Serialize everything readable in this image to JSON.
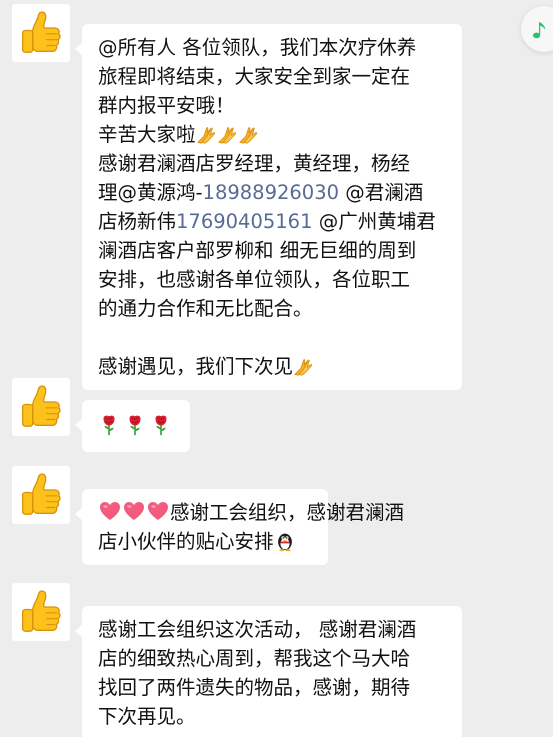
{
  "colors": {
    "background": "#ededed",
    "bubble": "#ffffff",
    "text": "#111111",
    "phone_link": "#576b95",
    "music_note": "#2bc26b"
  },
  "floating": {
    "icon": "music-note-icon"
  },
  "messages": [
    {
      "avatar": "thumbs-up-avatar",
      "lines": [
        "@所有人 各位领队，我们本次疗休养",
        "旅程即将结束，大家安全到家一定在",
        "群内报平安哦！",
        "辛苦大家啦",
        "感谢君澜酒店罗经理，黄经理，杨经",
        "理@黄源鸿-",
        "18988926030",
        " @君澜酒",
        "店杨新伟",
        "17690405161",
        " @广州黄埔君",
        "澜酒店客户部罗柳和 细无巨细的周到",
        "安排，也感谢各单位领队，各位职工",
        "的通力合作和无比配合。",
        "感谢遇见，我们下次见"
      ],
      "emoji": [
        "folded-hands-emoji",
        "folded-hands-emoji",
        "folded-hands-emoji",
        "folded-hands-emoji"
      ]
    },
    {
      "avatar": "thumbs-up-avatar",
      "emoji": [
        "rose-emoji",
        "rose-emoji",
        "rose-emoji"
      ]
    },
    {
      "avatar": "thumbs-up-avatar",
      "lines": [
        "感谢工会组织，感谢君澜酒",
        "店小伙伴的贴心安排"
      ],
      "emoji": [
        "heart-emoji",
        "heart-emoji",
        "heart-emoji",
        "penguin-emoji"
      ]
    },
    {
      "avatar": "thumbs-up-avatar",
      "lines": [
        "感谢工会组织这次活动， 感谢君澜酒",
        "店的细致热心周到，帮我这个马大哈",
        "找回了两件遗失的物品，感谢，期待",
        "下次再见。"
      ]
    }
  ]
}
